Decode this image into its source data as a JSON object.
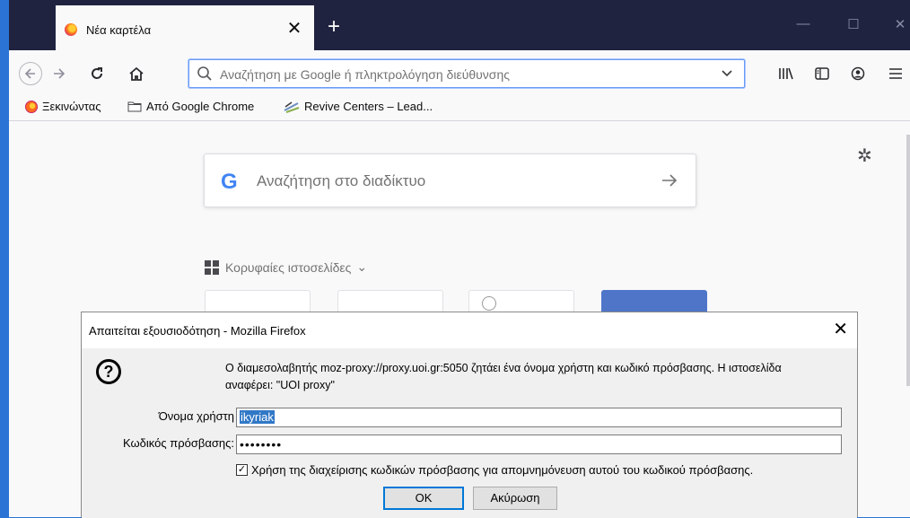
{
  "tab": {
    "title": "Νέα καρτέλα",
    "close": "✕",
    "new_tab": "+"
  },
  "window_controls": {
    "minimize": "—",
    "maximize": "☐",
    "close": "✕"
  },
  "urlbar": {
    "placeholder": "Αναζήτηση με Google ή πληκτρολόγηση διεύθυνσης"
  },
  "bookmarks": [
    {
      "label": "Ξεκινώντας"
    },
    {
      "label": "Από Google Chrome"
    },
    {
      "label": "Revive Centers – Lead..."
    }
  ],
  "newtab": {
    "search_placeholder": "Αναζήτηση στο διαδίκτυο",
    "google_letter": "G",
    "top_sites_label": "Κορυφαίες ιστοσελίδες",
    "top_sites_chevron": "⌄"
  },
  "dialog": {
    "title": "Απαιτείται εξουσιοδότηση - Mozilla Firefox",
    "close": "✕",
    "message": "Ο διαμεσολαβητής moz-proxy://proxy.uoi.gr:5050 ζητάει ένα όνομα χρήστη και κωδικό πρόσβασης. Η ιστοσελίδα αναφέρει: \"UOI proxy\"",
    "username_label": "Όνομα χρήστη",
    "username_value": "ikyriak",
    "password_label": "Κωδικός πρόσβασης:",
    "password_mask": "••••••••",
    "remember_label": "Χρήση της διαχείρισης κωδικών πρόσβασης για απομνημόνευση αυτού του κωδικού πρόσβασης.",
    "remember_checked": "✓",
    "ok_label": "OK",
    "cancel_label": "Ακύρωση"
  }
}
